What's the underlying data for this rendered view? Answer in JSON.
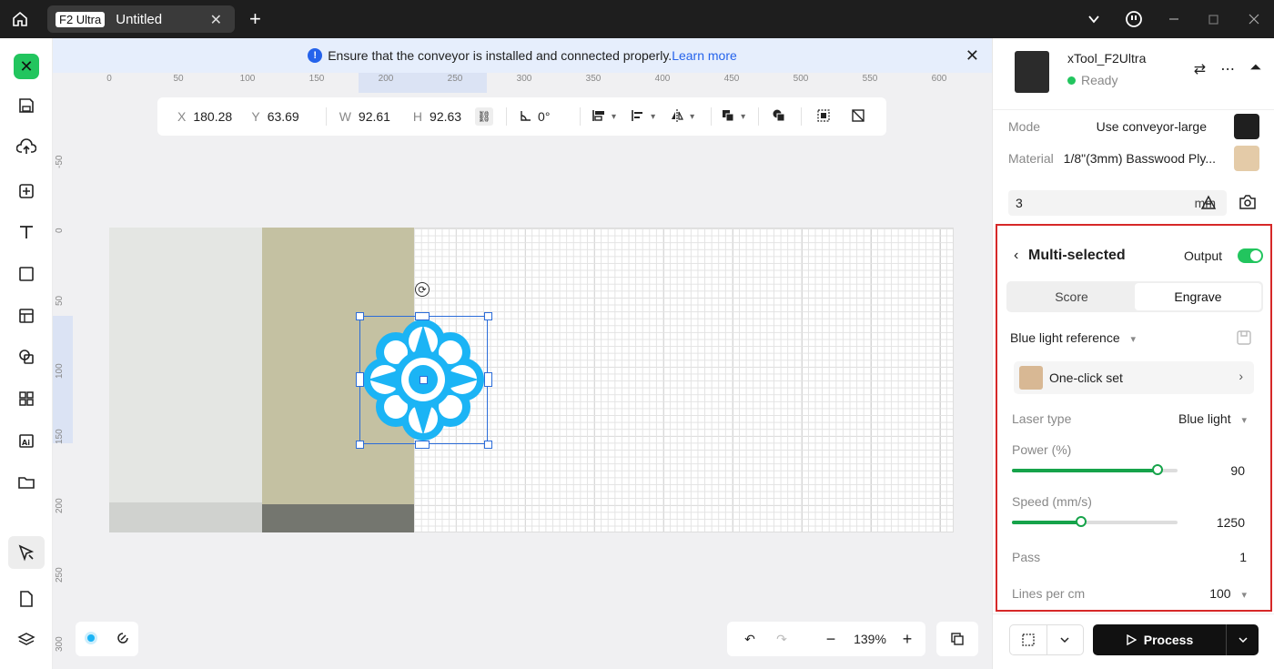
{
  "titlebar": {
    "badge": "F2 Ultra",
    "tab_title": "Untitled",
    "close": "✕",
    "new_tab": "+"
  },
  "banner": {
    "message": "Ensure that the conveyor is installed and connected properly.",
    "link": "Learn more"
  },
  "ruler": {
    "top": [
      "0",
      "50",
      "100",
      "150",
      "200",
      "250",
      "300",
      "350",
      "400",
      "450",
      "500",
      "550",
      "600"
    ],
    "left": [
      "-50",
      "0",
      "50",
      "100",
      "150",
      "200",
      "250",
      "300"
    ]
  },
  "props": {
    "x_label": "X",
    "x": "180.28",
    "y_label": "Y",
    "y": "63.69",
    "w_label": "W",
    "w": "92.61",
    "h_label": "H",
    "h": "92.63",
    "angle": "0°"
  },
  "zoom": {
    "value": "139%",
    "minus": "−",
    "plus": "+"
  },
  "device": {
    "name": "xTool_F2Ultra",
    "status": "Ready"
  },
  "settings": {
    "mode_label": "Mode",
    "mode": "Use conveyor-large",
    "material_label": "Material",
    "material": "1/8\"(3mm) Basswood Ply...",
    "thickness": "3",
    "thickness_unit": "mm"
  },
  "panel": {
    "title": "Multi-selected",
    "output_label": "Output",
    "tabs": [
      "Score",
      "Engrave"
    ],
    "reference": "Blue light reference",
    "one_click": "One-click set",
    "laser_type_label": "Laser type",
    "laser_type": "Blue light",
    "power_label": "Power (%)",
    "power": "90",
    "speed_label": "Speed (mm/s)",
    "speed": "1250",
    "pass_label": "Pass",
    "pass": "1",
    "lines_label": "Lines per cm",
    "lines": "100"
  },
  "process_label": "Process",
  "colors": {
    "accent": "#22c55e",
    "selection": "#2b6cd9",
    "shape": "#1bb4f5",
    "highlight_border": "#d62828"
  }
}
